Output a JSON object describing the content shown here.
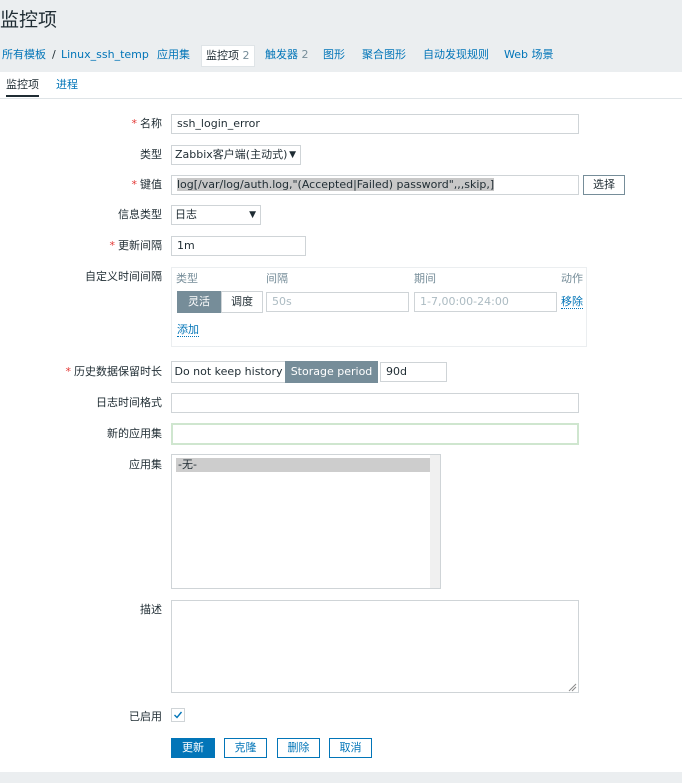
{
  "page": {
    "title": "监控项"
  },
  "nav": {
    "breadcrumb_all": "所有模板",
    "breadcrumb_sep": "/",
    "breadcrumb_host": "Linux_ssh_temp",
    "apps": "应用集",
    "items": "监控项",
    "items_count": "2",
    "triggers": "触发器",
    "triggers_count": "2",
    "graphs": "图形",
    "screens": "聚合图形",
    "discovery": "自动发现规则",
    "web": "Web 场景"
  },
  "tabs": {
    "item": "监控项",
    "preprocessing": "进程"
  },
  "form": {
    "required_mark": "*",
    "name_label": "名称",
    "name_value": "ssh_login_error",
    "type_label": "类型",
    "type_value": "Zabbix客户端(主动式)",
    "key_label": "键值",
    "key_value": "log[/var/log/auth.log,\"(Accepted|Failed) password\",,,skip,]",
    "select_button": "选择",
    "info_type_label": "信息类型",
    "info_type_value": "日志",
    "interval_label": "更新间隔",
    "interval_value": "1m",
    "custom_label": "自定义时间间隔",
    "custom_hdr_type": "类型",
    "custom_hdr_interval": "间隔",
    "custom_hdr_period": "期间",
    "custom_hdr_action": "动作",
    "custom_flexible": "灵活",
    "custom_scheduling": "调度",
    "custom_interval_ph": "50s",
    "custom_period_ph": "1-7,00:00-24:00",
    "custom_remove": "移除",
    "custom_add": "添加",
    "history_label": "历史数据保留时长",
    "history_no_keep": "Do not keep history",
    "history_storage": "Storage period",
    "history_value": "90d",
    "logtime_label": "日志时间格式",
    "logtime_value": "",
    "new_app_label": "新的应用集",
    "new_app_value": "",
    "apps_label": "应用集",
    "apps_option": "-无-",
    "desc_label": "描述",
    "desc_value": "",
    "enabled_label": "已启用",
    "update": "更新",
    "clone": "克隆",
    "delete": "删除",
    "cancel": "取消"
  },
  "colors": {
    "link": "#0275b8",
    "accent": "#0275b8",
    "required": "#e33734",
    "segment_on": "#768d99"
  }
}
